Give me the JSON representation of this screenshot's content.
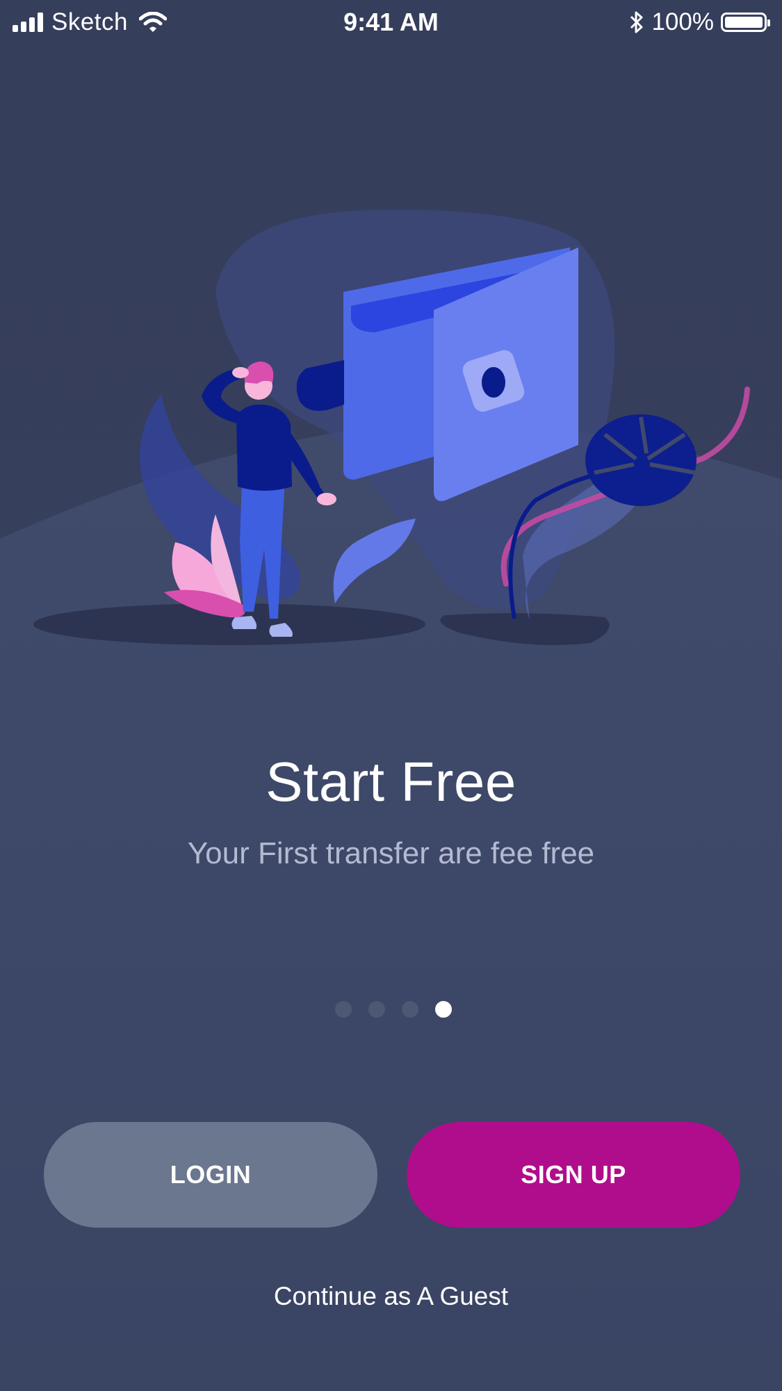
{
  "status_bar": {
    "carrier": "Sketch",
    "time": "9:41 AM",
    "battery": "100%",
    "icons": [
      "signal-icon",
      "wifi-icon",
      "bluetooth-icon",
      "battery-icon"
    ]
  },
  "onboarding": {
    "illustration": "person-with-wallet-illustration",
    "title": "Start Free",
    "subtitle": "Your First transfer are fee free",
    "page_indicator": {
      "total": 4,
      "current": 4
    }
  },
  "actions": {
    "login_label": "LOGIN",
    "signup_label": "SIGN UP",
    "guest_label": "Continue as A Guest"
  },
  "colors": {
    "background": "#363F5C",
    "login_button": "#6B778E",
    "signup_button": "#B00D8C",
    "subtitle_text": "#B4BAD0",
    "accent_blue": "#6A7FEF",
    "accent_pink": "#D94FAE"
  }
}
